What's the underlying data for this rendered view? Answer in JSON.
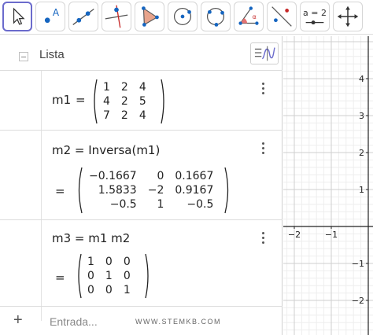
{
  "toolbar": {
    "tools": [
      {
        "icon": "pointer-icon",
        "active": true
      },
      {
        "icon": "point-icon",
        "label": "A"
      },
      {
        "icon": "line-icon"
      },
      {
        "icon": "perpendicular-line-icon"
      },
      {
        "icon": "polygon-icon"
      },
      {
        "icon": "circle-center-point-icon"
      },
      {
        "icon": "circle-three-points-icon"
      },
      {
        "icon": "angle-icon"
      },
      {
        "icon": "reflect-icon"
      },
      {
        "icon": "slider-icon",
        "label": "a = 2"
      },
      {
        "icon": "move-view-icon"
      }
    ]
  },
  "algebra": {
    "list_title": "Lista",
    "row1": {
      "lhs": "m1",
      "eq": "=",
      "matrix": [
        [
          "1",
          "2",
          "4"
        ],
        [
          "4",
          "2",
          "5"
        ],
        [
          "7",
          "2",
          "4"
        ]
      ]
    },
    "row2": {
      "definition": "m2 = Inversa(m1)",
      "eq": "=",
      "matrix": [
        [
          "−0.1667",
          "0",
          "0.1667"
        ],
        [
          "1.5833",
          "−2",
          "0.9167"
        ],
        [
          "−0.5",
          "1",
          "−0.5"
        ]
      ]
    },
    "row3": {
      "definition": "m3 = m1 m2",
      "eq": "=",
      "matrix": [
        [
          "1",
          "0",
          "0"
        ],
        [
          "0",
          "1",
          "0"
        ],
        [
          "0",
          "0",
          "1"
        ]
      ]
    },
    "input": {
      "plus": "+",
      "placeholder": "Entrada..."
    },
    "watermark": "WWW.STEMKB.COM"
  },
  "graphics": {
    "y_ticks": [
      "4",
      "3",
      "2",
      "1",
      "−1",
      "−2"
    ],
    "x_ticks": [
      "−2",
      "−1"
    ]
  },
  "colors": {
    "accent": "#6b6bcc",
    "point": "#1565c0",
    "polygon_fill": "#e8a48c",
    "angle": "#c62828"
  }
}
